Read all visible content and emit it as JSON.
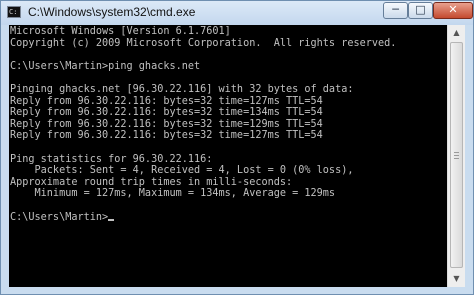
{
  "window": {
    "title": "C:\\Windows\\system32\\cmd.exe",
    "icon": "cmd-icon",
    "buttons": {
      "minimize": "─",
      "maximize": "□",
      "close": "✕"
    }
  },
  "console": {
    "lines": [
      "Microsoft Windows [Version 6.1.7601]",
      "Copyright (c) 2009 Microsoft Corporation.  All rights reserved.",
      "",
      "C:\\Users\\Martin>ping ghacks.net",
      "",
      "Pinging ghacks.net [96.30.22.116] with 32 bytes of data:",
      "Reply from 96.30.22.116: bytes=32 time=127ms TTL=54",
      "Reply from 96.30.22.116: bytes=32 time=134ms TTL=54",
      "Reply from 96.30.22.116: bytes=32 time=129ms TTL=54",
      "Reply from 96.30.22.116: bytes=32 time=127ms TTL=54",
      "",
      "Ping statistics for 96.30.22.116:",
      "    Packets: Sent = 4, Received = 4, Lost = 0 (0% loss),",
      "Approximate round trip times in milli-seconds:",
      "    Minimum = 127ms, Maximum = 134ms, Average = 129ms",
      "",
      "C:\\Users\\Martin>"
    ]
  },
  "colors": {
    "console_bg": "#000000",
    "console_text": "#c0c0c0",
    "close_button": "#c44a2f"
  }
}
